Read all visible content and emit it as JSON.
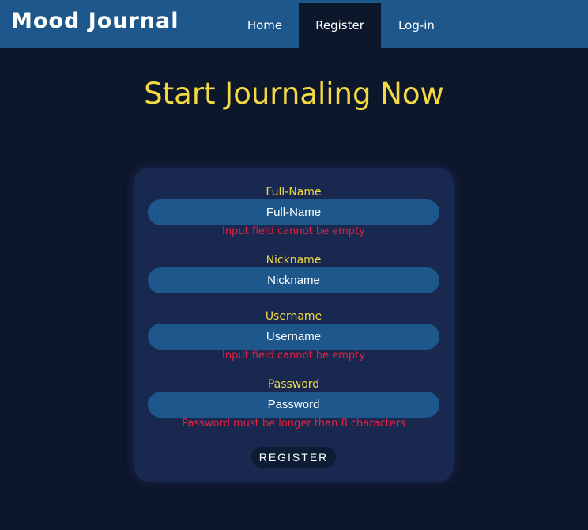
{
  "navbar": {
    "brand": "Mood Journal",
    "items": [
      {
        "label": "Home",
        "active": false
      },
      {
        "label": "Register",
        "active": true
      },
      {
        "label": "Log-in",
        "active": false
      }
    ]
  },
  "main": {
    "title": "Start Journaling Now"
  },
  "form": {
    "fields": [
      {
        "label": "Full-Name",
        "placeholder": "Full-Name",
        "value": "",
        "error": "Input field cannot be empty"
      },
      {
        "label": "Nickname",
        "placeholder": "Nickname",
        "value": "",
        "error": ""
      },
      {
        "label": "Username",
        "placeholder": "Username",
        "value": "",
        "error": "Input field cannot be empty"
      },
      {
        "label": "Password",
        "placeholder": "Password",
        "value": "",
        "error": "Password must be longer than 8 characters"
      }
    ],
    "submit_label": "REGISTER"
  },
  "colors": {
    "navbar": "#1d578b",
    "background": "#0d172b",
    "card": "#18284f",
    "accent": "#f4d943",
    "error": "#e8203f"
  }
}
